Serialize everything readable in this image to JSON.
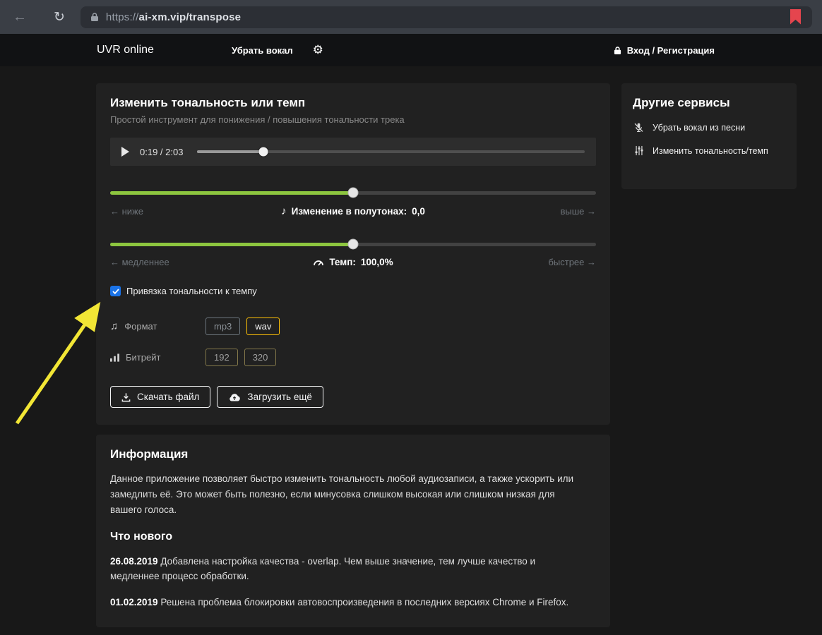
{
  "browser": {
    "url_scheme": "https://",
    "url_rest": "ai-xm.vip/transpose"
  },
  "navbar": {
    "brand": "UVR online",
    "vocal_link": "Убрать вокал",
    "login": "Вход / Регистрация"
  },
  "transpose_card": {
    "title": "Изменить тональность или темп",
    "subtitle": "Простой инструмент для понижения / повышения тональности трека",
    "player": {
      "time": "0:19 / 2:03",
      "progress_pct": 17
    },
    "pitch": {
      "pct": 50,
      "left_label": "← ниже",
      "center_label": "Изменение в полутонах:",
      "value": "0,0",
      "right_label": "выше →"
    },
    "tempo": {
      "pct": 50,
      "left_label": "← медленнее",
      "center_label": "Темп:",
      "value": "100,0%",
      "right_label": "быстрее →"
    },
    "link_checkbox_label": "Привязка тональности к темпу",
    "format": {
      "label": "Формат",
      "options": [
        "mp3",
        "wav"
      ],
      "selected": "wav"
    },
    "bitrate": {
      "label": "Битрейт",
      "options": [
        "192",
        "320"
      ]
    },
    "download_button": "Скачать файл",
    "upload_button": "Загрузить ещё"
  },
  "services_card": {
    "title": "Другие сервисы",
    "items": [
      {
        "label": "Убрать вокал из песни"
      },
      {
        "label": "Изменить тональность/темп"
      }
    ]
  },
  "info_card": {
    "title": "Информация",
    "paragraph": "Данное приложение позволяет быстро изменить тональность любой аудиозаписи, а также ускорить или замедлить её. Это может быть полезно, если минусовка слишком высокая или слишком низкая для вашего голоса.",
    "whats_new_title": "Что нового",
    "entries": [
      {
        "date": "26.08.2019",
        "text": "Добавлена настройка качества - overlap. Чем выше значение, тем лучше качество и медленнее процесс обработки."
      },
      {
        "date": "01.02.2019",
        "text": "Решена проблема блокировки автовоспроизведения в последних версиях Chrome и Firefox."
      }
    ]
  },
  "colors": {
    "slider_green": "#8dc63f",
    "selected_yellow": "#ffc107",
    "checkbox_blue": "#1a73e8",
    "bookmark_red": "#e5454e",
    "arrow_yellow": "#f2e635"
  }
}
